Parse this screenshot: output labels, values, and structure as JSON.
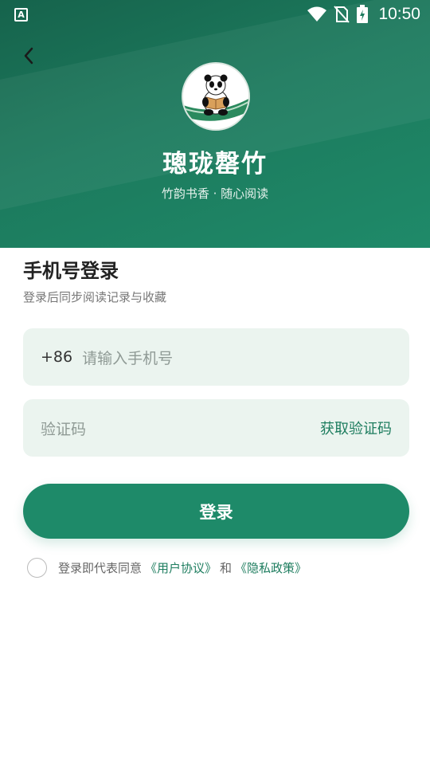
{
  "status_bar": {
    "app_icon_letter": "A",
    "time": "10:50",
    "icons": [
      "wifi-icon",
      "no-sim-icon",
      "battery-charging-icon"
    ]
  },
  "header": {
    "back_icon": "chevron-left-icon",
    "app_name": "璁珑罄竹",
    "slogan": "竹韵书香 · 随心阅读",
    "logo": "panda-reading-logo"
  },
  "login": {
    "title": "手机号登录",
    "subtitle": "登录后同步阅读记录与收藏",
    "phone_prefix": "+86",
    "phone_placeholder": "请输入手机号",
    "code_placeholder": "验证码",
    "get_code_label": "获取验证码",
    "submit_label": "登录"
  },
  "agreement": {
    "checked": false,
    "prefix_text": "登录即代表同意",
    "user_agreement": "《用户协议》",
    "and_text": "和",
    "privacy_policy": "《隐私政策》"
  },
  "colors": {
    "brand": "#1e8a69",
    "header_dark": "#16634c",
    "field_bg": "#ebf4ef",
    "link": "#1e7d5f"
  }
}
